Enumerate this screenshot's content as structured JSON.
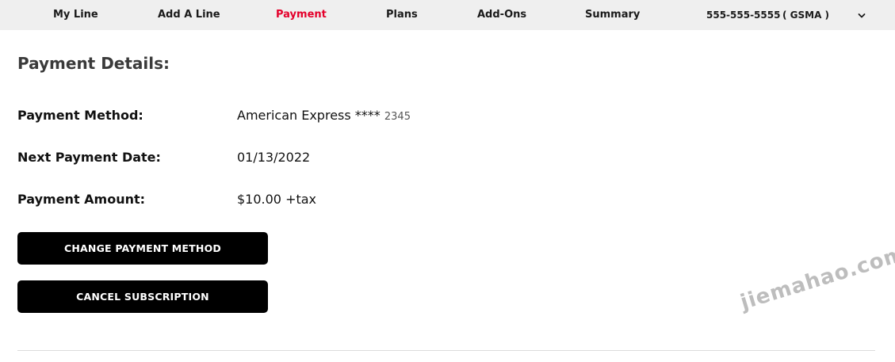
{
  "nav": {
    "items": [
      {
        "label": "My Line",
        "active": false
      },
      {
        "label": "Add A Line",
        "active": false
      },
      {
        "label": "Payment",
        "active": true
      },
      {
        "label": "Plans",
        "active": false
      },
      {
        "label": "Add-Ons",
        "active": false
      },
      {
        "label": "Summary",
        "active": false
      }
    ],
    "phone_number": "555-555-5555",
    "carrier": "( GSMA )",
    "dropdown_icon": "chevron-down-icon"
  },
  "payment": {
    "title": "Payment Details:",
    "method_label": "Payment Method:",
    "method_value": "American Express ****",
    "method_last_digits": "2345",
    "next_date_label": "Next Payment Date:",
    "next_date_value": "01/13/2022",
    "amount_label": "Payment Amount:",
    "amount_value": "$10.00 +tax"
  },
  "buttons": {
    "change_method": "CHANGE PAYMENT METHOD",
    "cancel_subscription": "CANCEL SUBSCRIPTION"
  },
  "watermark": "jiemahao.com",
  "colors": {
    "active_nav": "#e4002b",
    "nav_bg": "#efefef",
    "button_bg": "#000000"
  }
}
